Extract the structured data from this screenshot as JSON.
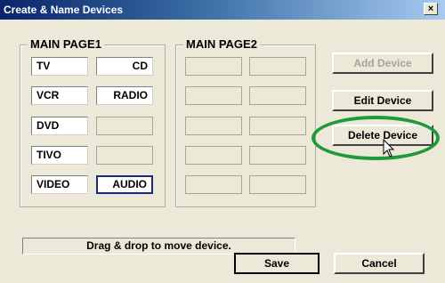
{
  "window": {
    "title": "Create & Name Devices",
    "close_label": "×"
  },
  "page1": {
    "title": "MAIN PAGE1",
    "slots": [
      {
        "label": "TV",
        "align": "left",
        "state": "filled"
      },
      {
        "label": "CD",
        "align": "right",
        "state": "filled"
      },
      {
        "label": "VCR",
        "align": "left",
        "state": "filled"
      },
      {
        "label": "RADIO",
        "align": "right",
        "state": "filled"
      },
      {
        "label": "DVD",
        "align": "left",
        "state": "filled"
      },
      {
        "label": "",
        "align": "left",
        "state": "empty"
      },
      {
        "label": "TIVO",
        "align": "left",
        "state": "filled"
      },
      {
        "label": "",
        "align": "left",
        "state": "empty"
      },
      {
        "label": "VIDEO",
        "align": "left",
        "state": "filled"
      },
      {
        "label": "AUDIO",
        "align": "right",
        "state": "selected"
      }
    ]
  },
  "page2": {
    "title": "MAIN PAGE2",
    "slots": [
      "",
      "",
      "",
      "",
      "",
      "",
      "",
      "",
      "",
      ""
    ]
  },
  "buttons": {
    "add_device": "Add Device",
    "edit_device": "Edit Device",
    "delete_device": "Delete Device",
    "save": "Save",
    "cancel": "Cancel"
  },
  "status": {
    "hint": "Drag & drop to move device."
  },
  "colors": {
    "highlight_ring": "#1f9a3b",
    "selected_border": "#1c2b7a",
    "title_bar_start": "#0a246a"
  },
  "icons": {
    "cursor": "mouse-pointer-icon",
    "close": "close-icon"
  }
}
